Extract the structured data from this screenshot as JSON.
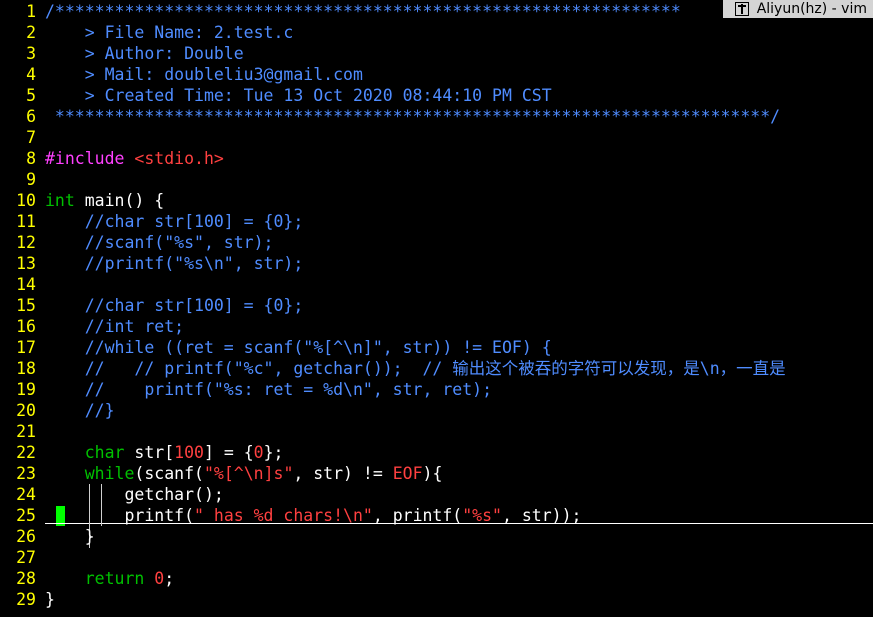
{
  "window": {
    "title": "Aliyun(hz) - vim",
    "icon": "pin-icon"
  },
  "editor": {
    "colors": {
      "line_number": "#ffff00",
      "comment": "#4f8cff",
      "preprocessor": "#ff40ff",
      "type": "#00c000",
      "string": "#ff4040",
      "change_marker": "#00ff00",
      "background": "#000000"
    },
    "cursor_line": 25,
    "lines": [
      {
        "n": "1",
        "segments": [
          {
            "c": "c-comment",
            "t": "/*"
          },
          {
            "c": "c-comment",
            "t": "**************************************************************"
          }
        ]
      },
      {
        "n": "2",
        "segments": [
          {
            "c": "c-comment",
            "t": "    > File Name: 2.test.c"
          }
        ]
      },
      {
        "n": "3",
        "segments": [
          {
            "c": "c-comment",
            "t": "    > Author: Double"
          }
        ]
      },
      {
        "n": "4",
        "segments": [
          {
            "c": "c-comment",
            "t": "    > Mail: doubleliu3@gmail.com"
          }
        ]
      },
      {
        "n": "5",
        "segments": [
          {
            "c": "c-comment",
            "t": "    > Created Time: Tue 13 Oct 2020 08:44:10 PM CST"
          }
        ]
      },
      {
        "n": "6",
        "segments": [
          {
            "c": "c-comment",
            "t": " ************************************************************************/"
          }
        ]
      },
      {
        "n": "7",
        "segments": []
      },
      {
        "n": "8",
        "segments": [
          {
            "c": "c-pre",
            "t": "#include "
          },
          {
            "c": "c-str",
            "t": "<stdio.h>"
          }
        ]
      },
      {
        "n": "9",
        "segments": []
      },
      {
        "n": "10",
        "segments": [
          {
            "c": "c-type",
            "t": "int"
          },
          {
            "c": "c-plain",
            "t": " main() {"
          }
        ]
      },
      {
        "n": "11",
        "segments": [
          {
            "c": "c-comment",
            "t": "    //char str[100] = {0};"
          }
        ]
      },
      {
        "n": "12",
        "segments": [
          {
            "c": "c-comment",
            "t": "    //scanf(\"%s\", str);"
          }
        ]
      },
      {
        "n": "13",
        "segments": [
          {
            "c": "c-comment",
            "t": "    //printf(\"%s\\n\", str);"
          }
        ]
      },
      {
        "n": "14",
        "segments": []
      },
      {
        "n": "15",
        "segments": [
          {
            "c": "c-comment",
            "t": "    //char str[100] = {0};"
          }
        ]
      },
      {
        "n": "16",
        "segments": [
          {
            "c": "c-comment",
            "t": "    //int ret;"
          }
        ]
      },
      {
        "n": "17",
        "segments": [
          {
            "c": "c-comment",
            "t": "    //while ((ret = scanf(\"%[^\\n]\", str)) != EOF) {"
          }
        ]
      },
      {
        "n": "18",
        "segments": [
          {
            "c": "c-comment",
            "t": "    //   // printf(\"%c\", getchar());  // 输出这个被吞的字符可以发现，是\\n，一直是"
          }
        ]
      },
      {
        "n": "19",
        "segments": [
          {
            "c": "c-comment",
            "t": "    //    printf(\"%s: ret = %d\\n\", str, ret);"
          }
        ]
      },
      {
        "n": "20",
        "segments": [
          {
            "c": "c-comment",
            "t": "    //}"
          }
        ]
      },
      {
        "n": "21",
        "segments": []
      },
      {
        "n": "22",
        "segments": [
          {
            "c": "c-gap",
            "t": "    "
          },
          {
            "c": "c-type",
            "t": "char"
          },
          {
            "c": "c-plain",
            "t": " str["
          },
          {
            "c": "c-str",
            "t": "100"
          },
          {
            "c": "c-plain",
            "t": "] = {"
          },
          {
            "c": "c-str",
            "t": "0"
          },
          {
            "c": "c-plain",
            "t": "};"
          }
        ]
      },
      {
        "n": "23",
        "segments": [
          {
            "c": "c-gap",
            "t": "    "
          },
          {
            "c": "c-type",
            "t": "while"
          },
          {
            "c": "c-plain",
            "t": "(scanf("
          },
          {
            "c": "c-str",
            "t": "\"%[^\\n]s\""
          },
          {
            "c": "c-plain",
            "t": ", str) != "
          },
          {
            "c": "c-str",
            "t": "EOF"
          },
          {
            "c": "c-plain",
            "t": "){"
          }
        ]
      },
      {
        "n": "24",
        "segments": [
          {
            "c": "c-plain",
            "t": "        getchar();"
          }
        ]
      },
      {
        "n": "25",
        "segments": [
          {
            "c": "c-plain",
            "t": "        printf("
          },
          {
            "c": "c-str",
            "t": "\" has %d chars!\\n\""
          },
          {
            "c": "c-plain",
            "t": ", printf("
          },
          {
            "c": "c-str",
            "t": "\"%s\""
          },
          {
            "c": "c-plain",
            "t": ", str));"
          }
        ]
      },
      {
        "n": "26",
        "segments": [
          {
            "c": "c-plain",
            "t": "    }"
          }
        ]
      },
      {
        "n": "27",
        "segments": []
      },
      {
        "n": "28",
        "segments": [
          {
            "c": "c-gap",
            "t": "    "
          },
          {
            "c": "c-type",
            "t": "return"
          },
          {
            "c": "c-plain",
            "t": " "
          },
          {
            "c": "c-str",
            "t": "0"
          },
          {
            "c": "c-plain",
            "t": ";"
          }
        ]
      },
      {
        "n": "29",
        "segments": [
          {
            "c": "c-plain",
            "t": "}"
          }
        ]
      }
    ]
  }
}
